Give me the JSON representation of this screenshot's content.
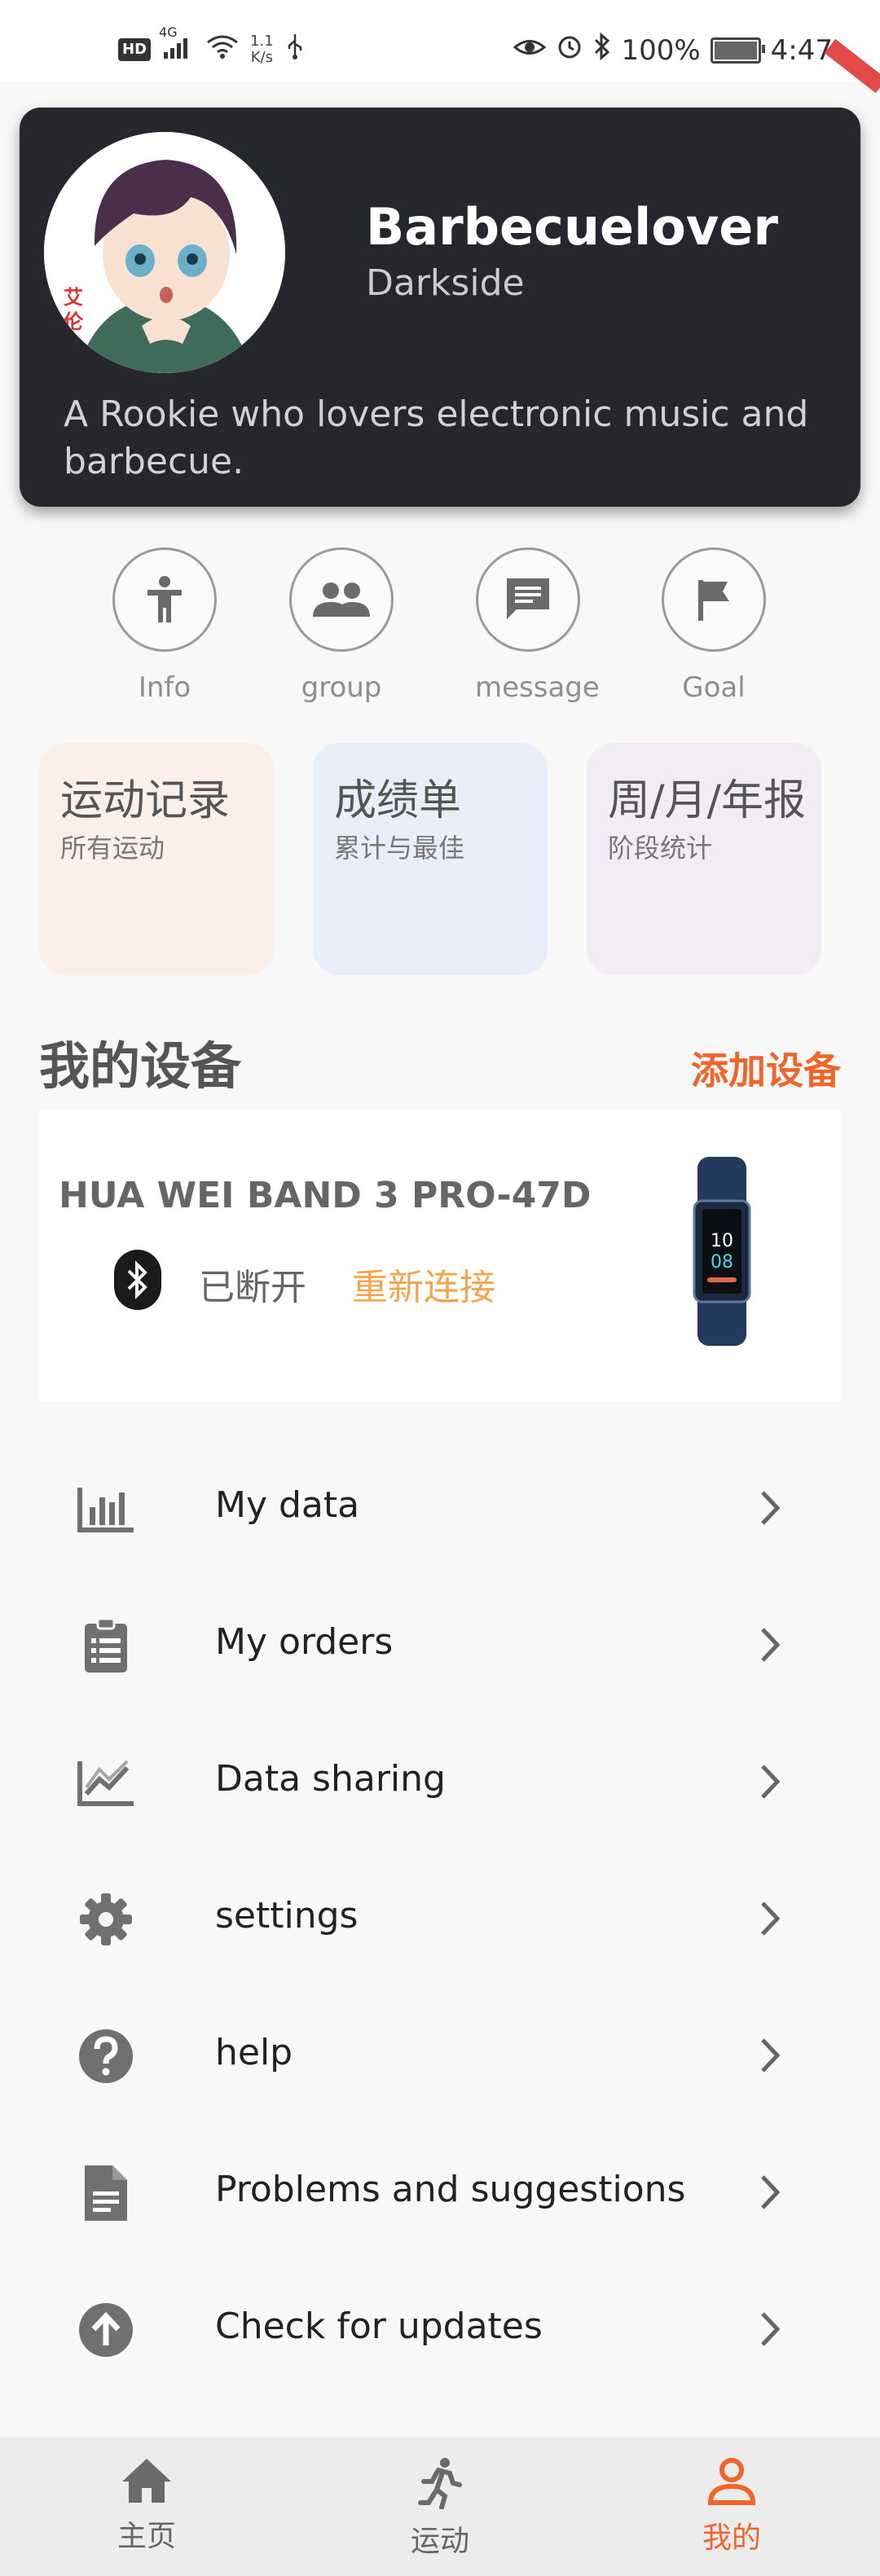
{
  "status_bar": {
    "hd": "HD",
    "network": "4G",
    "net_speed_value": "1.1",
    "net_speed_unit": "K/s",
    "battery": "100%",
    "time": "4:47"
  },
  "profile": {
    "name": "Barbecuelover",
    "subtitle": "Darkside",
    "bio": "A Rookie who lovers electronic music and barbecue.",
    "avatar_text": "艾伦"
  },
  "quick_actions": [
    {
      "label": "Info",
      "icon": "person-icon"
    },
    {
      "label": "group",
      "icon": "group-icon"
    },
    {
      "label": "message",
      "icon": "message-icon"
    },
    {
      "label": "Goal",
      "icon": "flag-icon"
    }
  ],
  "cards": [
    {
      "title": "运动记录",
      "subtitle": "所有运动",
      "color": "#fbefe8"
    },
    {
      "title": "成绩单",
      "subtitle": "累计与最佳",
      "color": "#e9effa"
    },
    {
      "title": "周/月/年报",
      "subtitle": "阶段统计",
      "color": "#f2edf5"
    }
  ],
  "devices": {
    "title": "我的设备",
    "add_label": "添加设备",
    "device_name": "HUA WEI BAND 3 PRO-47D",
    "status": "已断开",
    "reconnect_label": "重新连接",
    "band_time_top": "10",
    "band_time_bottom": "08"
  },
  "menu": [
    {
      "label": "My data",
      "icon": "bar-chart-icon"
    },
    {
      "label": "My orders",
      "icon": "clipboard-icon"
    },
    {
      "label": "Data sharing",
      "icon": "trending-icon"
    },
    {
      "label": "settings",
      "icon": "gear-icon"
    },
    {
      "label": "help",
      "icon": "help-icon"
    },
    {
      "label": "Problems and suggestions",
      "icon": "document-icon"
    },
    {
      "label": "Check for updates",
      "icon": "upload-icon"
    }
  ],
  "bottom_nav": [
    {
      "label": "主页",
      "icon": "home-icon",
      "active": false
    },
    {
      "label": "运动",
      "icon": "run-icon",
      "active": false
    },
    {
      "label": "我的",
      "icon": "profile-icon",
      "active": true
    }
  ],
  "colors": {
    "accent": "#f0652a",
    "reconnect": "#f2a54a",
    "card_dark": "#25272c"
  }
}
